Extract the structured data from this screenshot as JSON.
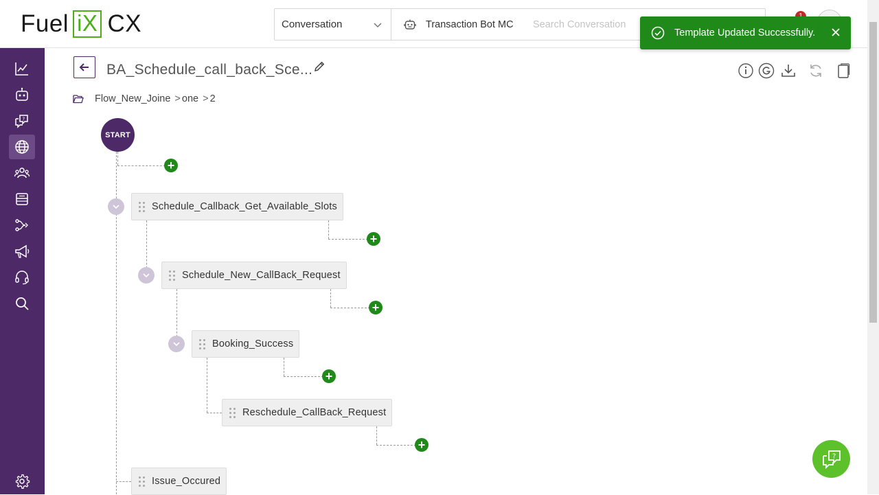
{
  "brand": {
    "name_left": "Fuel",
    "name_mid": "iX",
    "name_right": "CX"
  },
  "header": {
    "scope_value": "Conversation",
    "bot_name": "Transaction Bot MC",
    "search_placeholder": "Search Conversation",
    "notification_count": "1"
  },
  "toast": {
    "message": "Template Updated Successfully.",
    "color": "#1f8a1a"
  },
  "page": {
    "title": "BA_Schedule_call_back_Sce...",
    "breadcrumb": {
      "root": "Flow_New_Joine",
      "sep1": ">",
      "level1": "one",
      "sep2": ">",
      "level2": "2"
    }
  },
  "flow": {
    "start_label": "START",
    "nodes": [
      {
        "label": "Schedule_Callback_Get_Available_Slots"
      },
      {
        "label": "Schedule_New_CallBack_Request"
      },
      {
        "label": "Booking_Success"
      },
      {
        "label": "Reschedule_CallBack_Request"
      },
      {
        "label": "Issue_Occured"
      }
    ]
  },
  "sidebar": {
    "items": [
      {
        "icon": "analytics-icon"
      },
      {
        "icon": "bot-icon"
      },
      {
        "icon": "faq-icon"
      },
      {
        "icon": "globe-icon",
        "active": true
      },
      {
        "icon": "users-icon"
      },
      {
        "icon": "inbox-icon"
      },
      {
        "icon": "flow-icon"
      },
      {
        "icon": "megaphone-icon"
      },
      {
        "icon": "headset-icon"
      },
      {
        "icon": "search-icon"
      },
      {
        "icon": "settings-icon"
      }
    ]
  },
  "colors": {
    "primary": "#4d2a67",
    "success": "#1f8a1a",
    "accent_green": "#5cc12a"
  }
}
